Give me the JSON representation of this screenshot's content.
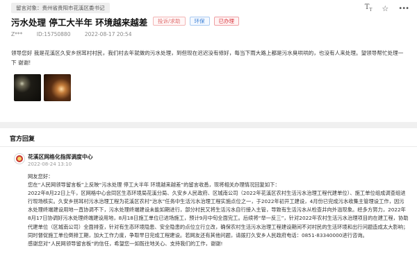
{
  "message": {
    "target_prefix": "留言对象：",
    "target": "贵州省贵阳市花溪区委书记",
    "title": "污水处理 停工大半年 环境越来越差",
    "tags": {
      "type": "投诉/求助",
      "domain": "环保",
      "status": "已办理"
    },
    "author": "Z***",
    "id_text": "ID:15750880",
    "time": "2022-08-17 20:54",
    "body": "领导您好 我是花溪区久安乡拐耳村村民，我们村去年就做的污水处理，到但现在迟迟没有修好，每当下雨大路上都是污水臭哄哄的，也没有人来处理。望领导帮忙处理一下 谢谢!",
    "photos": [
      "photo-night-road",
      "photo-night-light"
    ],
    "toolbar": {
      "font_size_icon": "font-size-icon",
      "favorite_icon": "star-icon",
      "more_icon": "more-icon"
    }
  },
  "reply_section": {
    "heading": "官方回复",
    "org_name": "花溪区网格化指挥调度中心",
    "time": "2022-08-24 13:10",
    "greeting": "网友您好：",
    "p1": "您在“人民网领导留言板”上反映“污水处理 停工大半年 环境越来越差”的留言收悉，现将相关办理情况回复如下：",
    "p2": "2022年8月22日上午，区网格中心会同区生态环境局花溪分局、久安乡人民政府、区城南公司（2022年花溪区农村生活污水治理工程代建单位）、施工单位组成调查组进行现场核实。久安乡拐耳村污水治理工程为花溪区农村“治水”任务中生活污水治理工程实施点位之一，于2022年初开工建设，4月份已完成污水收集主管理设工作，因污水处理终端建设用地一直协调不下，污水处理终端建设未能如期进行，部分村民又将生活污水自行接入主管，导致有生活污水从检查井向外溢现象。经多方努力，2022年8月17日协调好污水处理终端建设用地，8月18日施工单位已进场施工，预计9月中旬全面完工。后续将“举一反三”，针对2022年农村生活污水治理项目的在建工程，协助代建单位（区城南公司）全面排查，针对有生态环境隐患、安全隐患的点位立行立改，确保农村生活污水治理工程建设期间不对村民的生活环境和出行问题造成太大影响；同时督促施工单位倒排工期，加大工作力度，争取早日完成工程建设。若网友还有其他问题，请拨打久安乡人民政府电话：0851-83340000进行咨询。",
    "p3": "感谢您对“人民网领导留言板”的信任，希望您一如既往地关心、支持我们的工作，谢谢!"
  }
}
